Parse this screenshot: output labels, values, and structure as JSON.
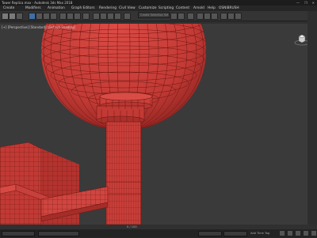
{
  "title": "Tower Replica.max - Autodesk 3ds Max 2018",
  "window_controls": [
    "—",
    "❐",
    "✕"
  ],
  "menu": [
    "Create",
    "Modifiers",
    "Animation",
    "Graph Editors",
    "Rendering",
    "Civil View",
    "Customize",
    "Scripting",
    "Content",
    "Arnold",
    "Help",
    "OSNIBRUSH"
  ],
  "selection_set": "Create Selection Set",
  "viewport_label": "[+] [Perspective] [Standard] [Default Shading]",
  "status": {
    "frame": "0 / 100",
    "add_time_tag": "Add Time Tag"
  },
  "colors": {
    "mesh": "#d2413d",
    "wire": "#6e1712",
    "background": "#3a3a3a"
  }
}
